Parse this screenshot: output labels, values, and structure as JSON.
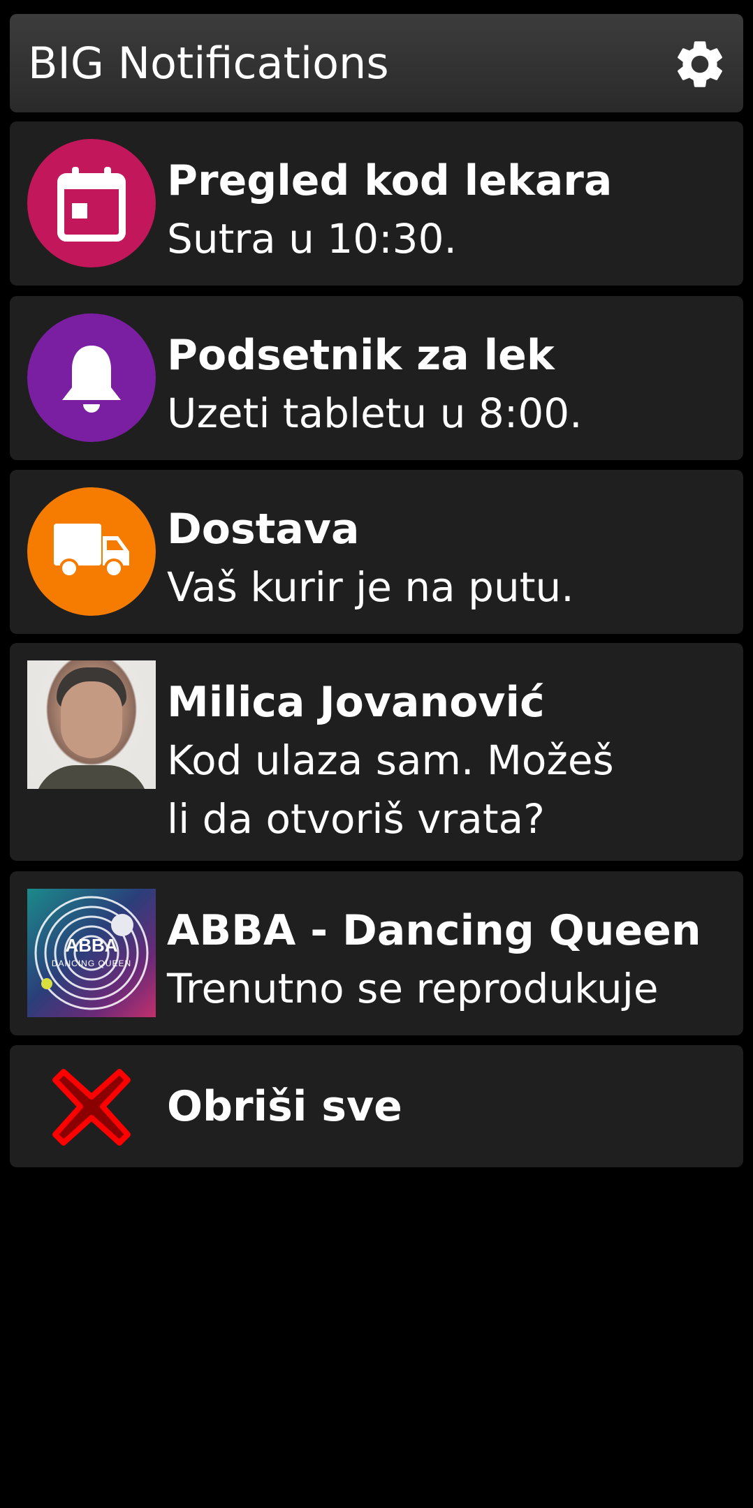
{
  "app": {
    "title": "BIG Notifications",
    "settings_icon": "gear-icon"
  },
  "notifications": [
    {
      "icon": "calendar-icon",
      "icon_color": "#c2185b",
      "title": "Pregled kod lekara",
      "body": "Sutra u 10:30."
    },
    {
      "icon": "bell-icon",
      "icon_color": "#7b1fa2",
      "title": "Podsetnik za lek",
      "body": "Uzeti tabletu u 8:00."
    },
    {
      "icon": "truck-icon",
      "icon_color": "#f57c00",
      "title": "Dostava",
      "body": "Vaš kurir je na putu."
    },
    {
      "icon": "contact-photo",
      "title": "Milica Jovanović",
      "body": "Kod ulaza sam. Možeš li da otvoriš vrata?"
    },
    {
      "icon": "album-art",
      "album_label": "ABBA",
      "album_sublabel": "DANCING QUEEN",
      "title": "ABBA - Dancing Queen",
      "body": "Trenutno se reprodukuje"
    }
  ],
  "clear_all": {
    "icon": "close-icon",
    "icon_color": "#ff0000",
    "label": "Obriši sve"
  }
}
